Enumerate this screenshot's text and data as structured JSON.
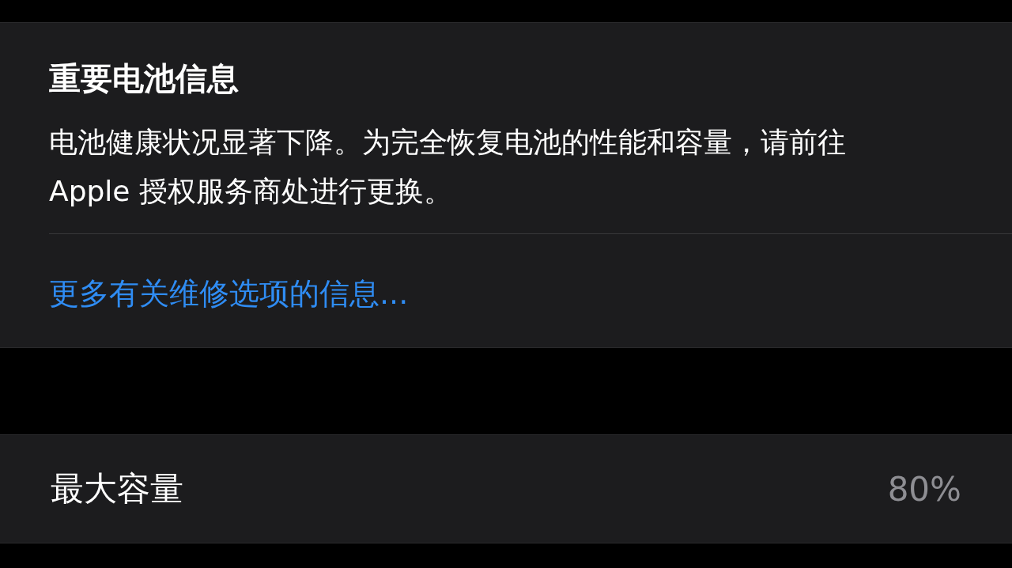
{
  "battery_notice": {
    "title": "重要电池信息",
    "message": "电池健康状况显著下降。为完全恢复电池的性能和容量，请前往 Apple 授权服务商处进行更换。",
    "link": "更多有关维修选项的信息..."
  },
  "capacity_row": {
    "label": "最大容量",
    "value": "80%"
  }
}
